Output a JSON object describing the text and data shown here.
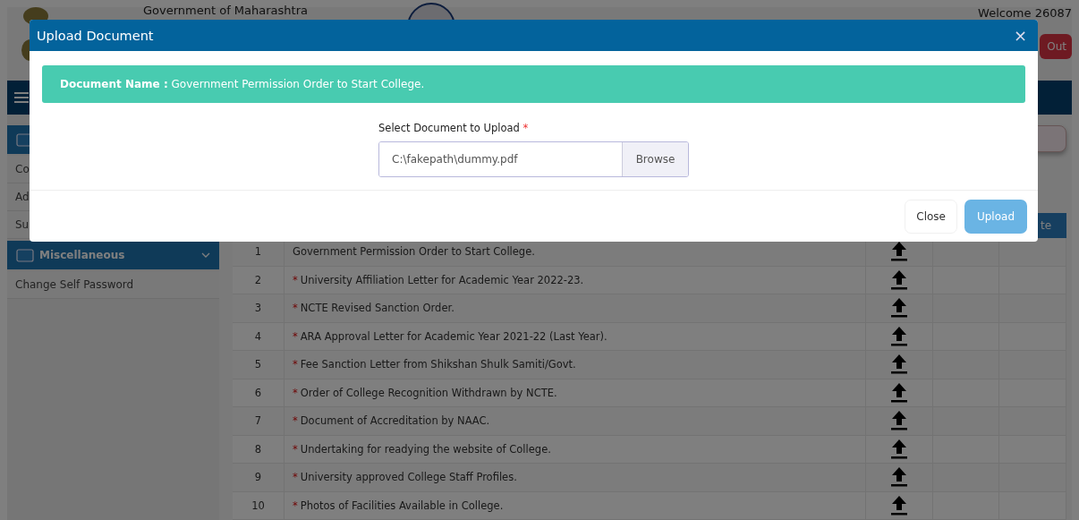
{
  "header": {
    "title": "Government of Maharashtra",
    "welcome": "Welcome 26087",
    "logout": "Out"
  },
  "sidebar": {
    "items": [
      {
        "kind": "group"
      },
      {
        "kind": "link",
        "label": "Co"
      },
      {
        "kind": "link",
        "label": "Ad"
      },
      {
        "kind": "link",
        "label": "Su"
      },
      {
        "kind": "group",
        "label": "Miscellaneous"
      },
      {
        "kind": "link",
        "label": "Change Self Password"
      }
    ]
  },
  "table": {
    "header_cell": "te",
    "rows": [
      {
        "number": "1",
        "document": "Government Permission Order to Start College."
      },
      {
        "number": "2",
        "mark": "*",
        "document": "University Affiliation Letter for Academic Year 2022-23."
      },
      {
        "number": "3",
        "mark": "*",
        "document": "NCTE Revised Sanction Order."
      },
      {
        "number": "4",
        "mark": "*",
        "document": "ARA Approval Letter for Academic Year 2021-22 (Last Year)."
      },
      {
        "number": "5",
        "mark": "*",
        "document": "Fee Sanction Letter from Shikshan Shulk Samiti/Govt."
      },
      {
        "number": "6",
        "mark": "*",
        "document": "Order of College Recognition Withdrawn by NCTE."
      },
      {
        "number": "7",
        "mark": "*",
        "document": "Document of Accreditation by NAAC."
      },
      {
        "number": "8",
        "mark": "*",
        "document": "Undertaking for readying the website of College."
      },
      {
        "number": "9",
        "mark": "*",
        "document": "University approved College Staff Profiles."
      },
      {
        "number": "10",
        "mark": "*",
        "document": "Photos of Facilities Available in College."
      }
    ]
  },
  "modal": {
    "title": "Upload Document",
    "close_icon": "×",
    "alert": "**Document Name :** Government Permission Order to Start College.",
    "field_label": "Select Document to Upload",
    "field_required_mark": "*",
    "file_value": "C:\\fakepath\\dummy.pdf",
    "browse": "Browse",
    "buttons": [
      {
        "label": "Close",
        "kind": "secondary"
      },
      {
        "label": "Upload",
        "kind": "primary"
      }
    ]
  }
}
